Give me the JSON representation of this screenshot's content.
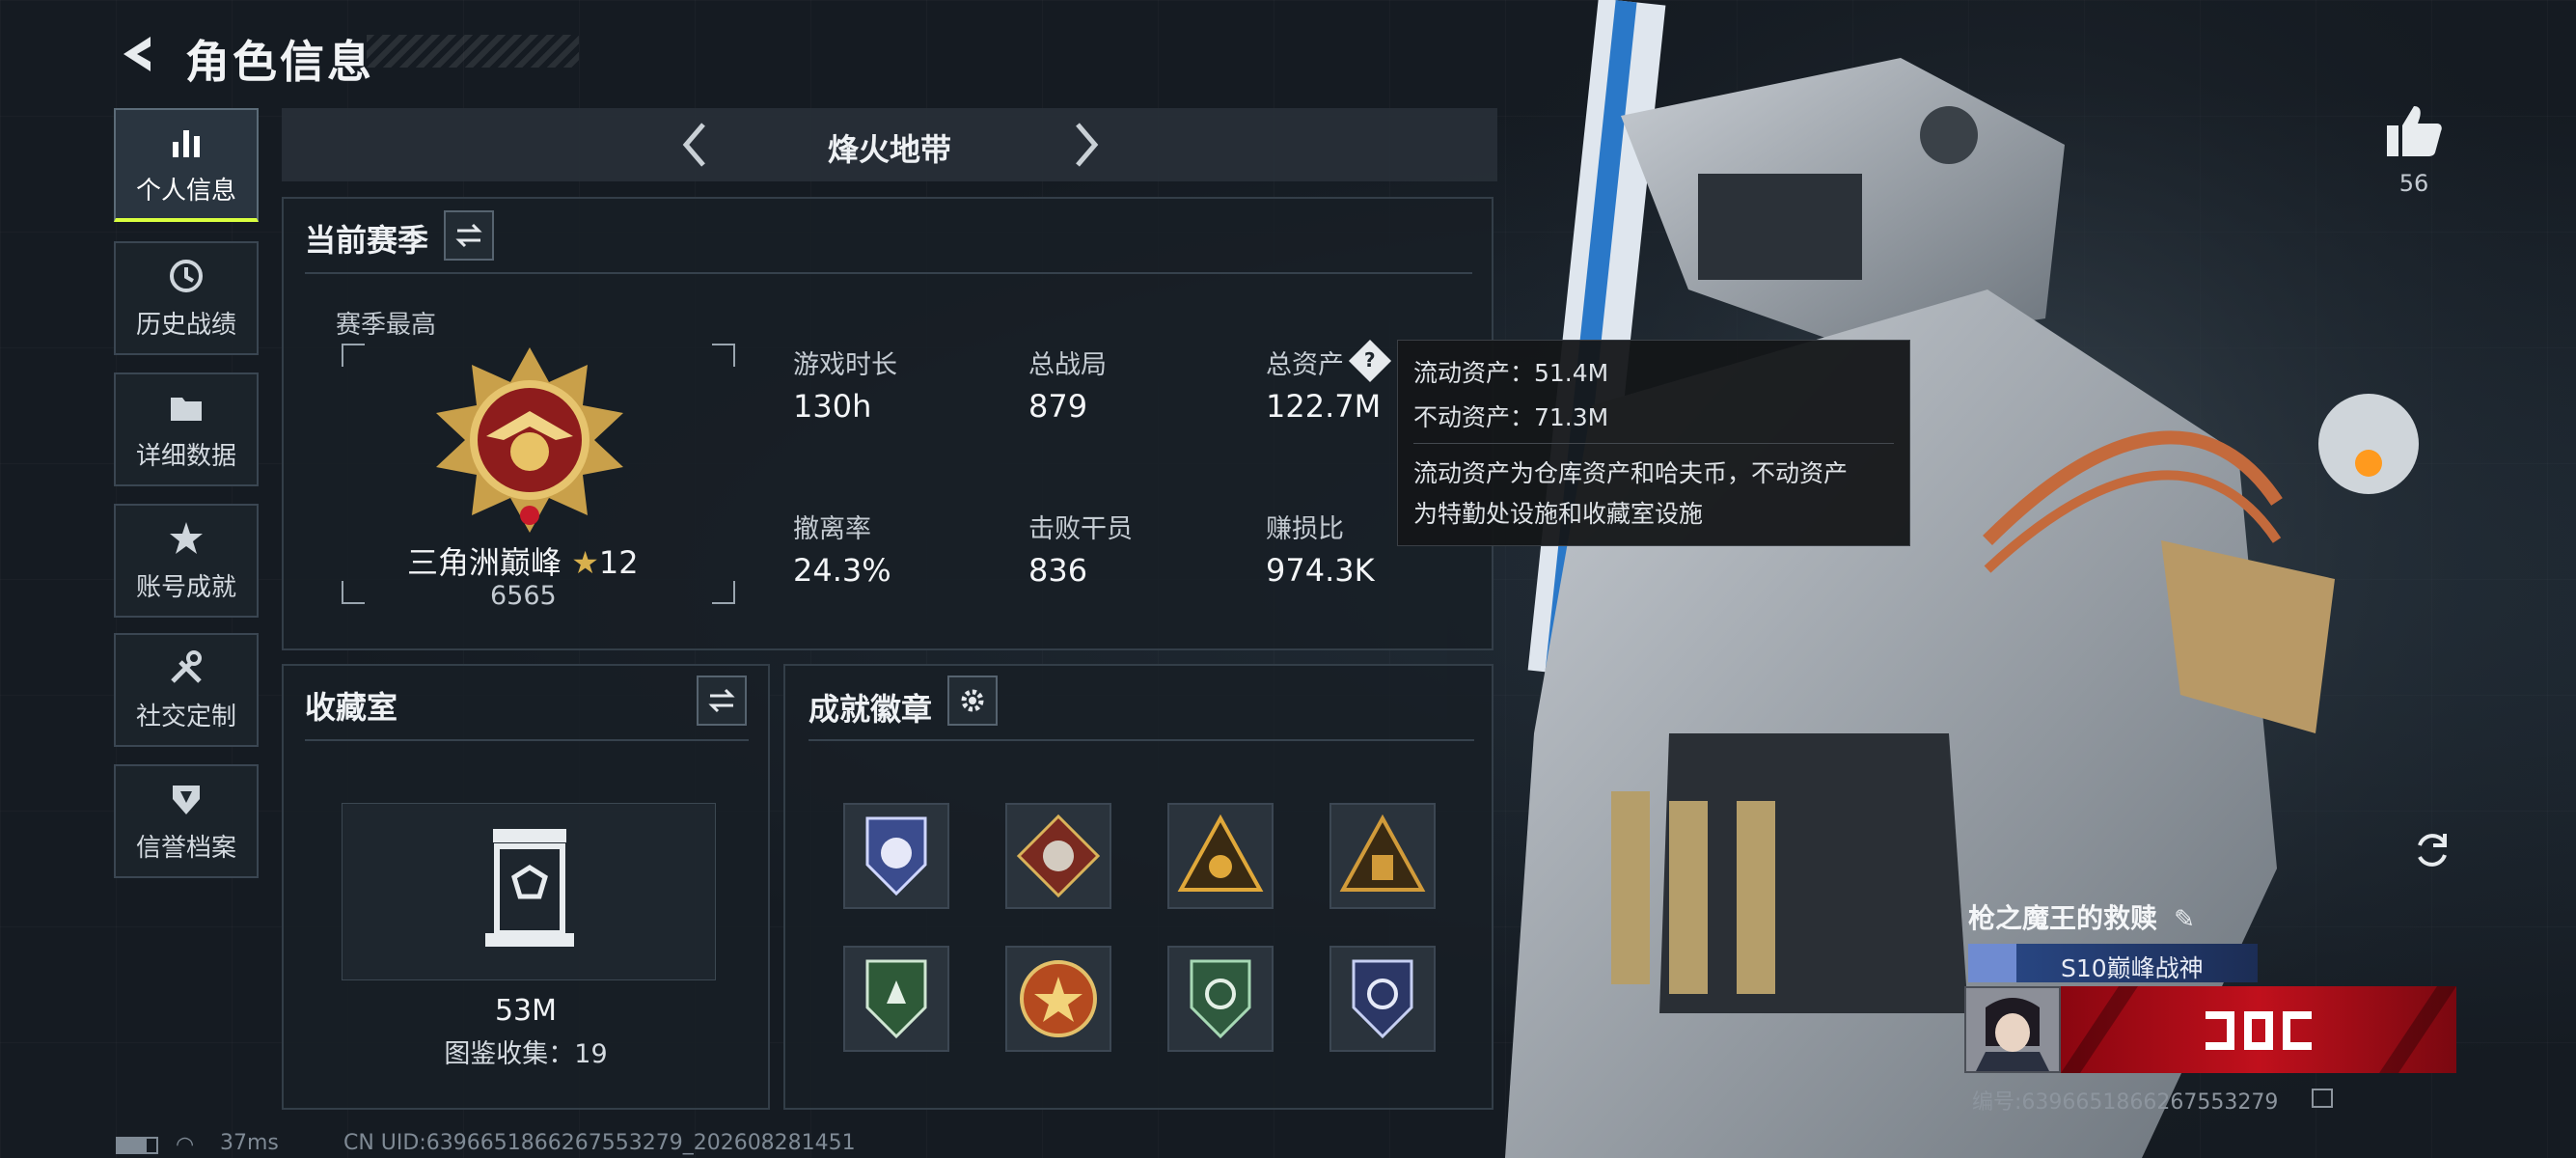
{
  "header": {
    "title": "角色信息"
  },
  "nav": [
    {
      "label": "个人信息",
      "icon": "bar-chart-icon",
      "active": true
    },
    {
      "label": "历史战绩",
      "icon": "history-clock-icon"
    },
    {
      "label": "详细数据",
      "icon": "folder-icon"
    },
    {
      "label": "账号成就",
      "icon": "achievement-star-icon"
    },
    {
      "label": "社交定制",
      "icon": "wrench-tools-icon"
    },
    {
      "label": "信誉档案",
      "icon": "reputation-shield-icon"
    }
  ],
  "mode": {
    "title": "烽火地带"
  },
  "season": {
    "title": "当前赛季",
    "best_label": "赛季最高",
    "rank_name": "三角洲巅峰",
    "rank_stars": "12",
    "rank_points": "6565",
    "stats": [
      {
        "label": "游戏时长",
        "value": "130h"
      },
      {
        "label": "总战局",
        "value": "879"
      },
      {
        "label": "总资产",
        "value": "122.7M"
      },
      {
        "label": "撤离率",
        "value": "24.3%"
      },
      {
        "label": "击败干员",
        "value": "836"
      },
      {
        "label": "赚损比",
        "value": "974.3K"
      }
    ]
  },
  "tooltip": {
    "line1": "流动资产：51.4M",
    "line2": "不动资产：71.3M",
    "line3": "流动资产为仓库资产和哈夫币，不动资产",
    "line4": "为特勤处设施和收藏室设施"
  },
  "collection": {
    "title": "收藏室",
    "value": "53M",
    "catalog": "图鉴收集：19"
  },
  "badges": {
    "title": "成就徽章",
    "items": [
      "badge-1",
      "badge-2",
      "badge-3",
      "badge-4",
      "badge-5",
      "badge-6",
      "badge-7",
      "badge-8"
    ]
  },
  "likes": {
    "count": "56"
  },
  "profile": {
    "name": "枪之魔王的救赎",
    "title_tag": "S10巅峰战神",
    "id_text": "编号:6396651866267553279"
  },
  "status_bar": {
    "ping": "37ms",
    "uid": "CN UID:6396651866267553279_202608281451"
  },
  "colors": {
    "accent": "#d9ff3f",
    "gold": "#c9a04a",
    "banner_red": "#c0101c"
  }
}
